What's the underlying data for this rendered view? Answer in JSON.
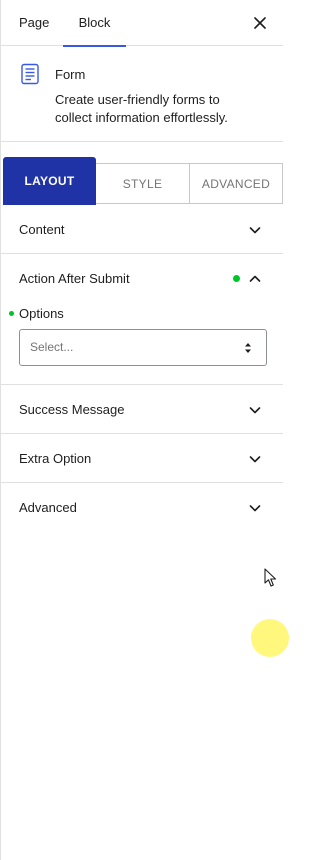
{
  "tabs": {
    "page_label": "Page",
    "block_label": "Block",
    "close_icon": "close-icon"
  },
  "block": {
    "icon": "form-icon",
    "title": "Form",
    "description": "Create user-friendly forms to collect information effortlessly."
  },
  "mode_tabs": {
    "layout": "LAYOUT",
    "style": "STYLE",
    "advanced": "ADVANCED",
    "active": "LAYOUT"
  },
  "sections": {
    "content": {
      "label": "Content",
      "expanded": false
    },
    "action_after_submit": {
      "label": "Action After Submit",
      "expanded": true,
      "options_label": "Options",
      "select_placeholder": "Select..."
    },
    "success_message": {
      "label": "Success Message",
      "expanded": false
    },
    "extra_option": {
      "label": "Extra Option",
      "expanded": false
    },
    "advanced": {
      "label": "Advanced",
      "expanded": false
    }
  },
  "colors": {
    "accent": "#1f32a6",
    "tab_underline": "#3858e9",
    "status_dot": "#00c52a",
    "border": "#e0e0e0"
  }
}
